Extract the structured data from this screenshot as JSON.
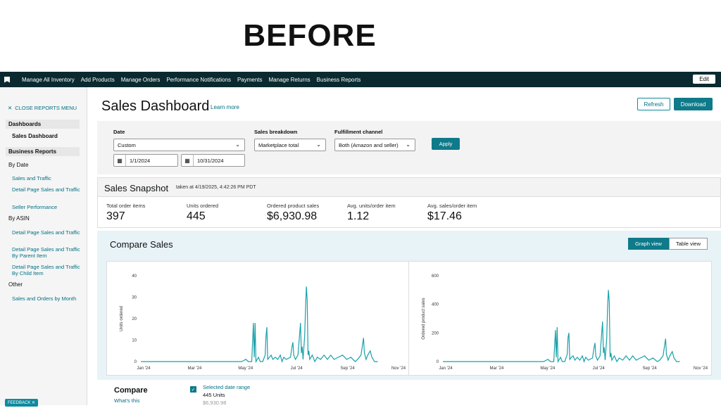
{
  "headline": "BEFORE",
  "topnav": {
    "items": [
      "Manage All Inventory",
      "Add Products",
      "Manage Orders",
      "Performance Notifications",
      "Payments",
      "Manage Returns",
      "Business Reports"
    ],
    "edit_label": "Edit"
  },
  "sidebar": {
    "close_label": "CLOSE REPORTS MENU",
    "dashboards_heading": "Dashboards",
    "sales_dashboard": "Sales Dashboard",
    "business_reports_heading": "Business Reports",
    "by_date_label": "By Date",
    "by_date_links": [
      "Sales and Traffic",
      "Detail Page Sales and Traffic",
      "Seller Performance"
    ],
    "by_asin_label": "By ASIN",
    "by_asin_links": [
      "Detail Page Sales and Traffic",
      "Detail Page Sales and Traffic By Parent Item",
      "Detail Page Sales and Traffic By Child Item"
    ],
    "other_label": "Other",
    "other_links": [
      "Sales and Orders by Month"
    ],
    "feedback_label": "FEEDBACK ✕"
  },
  "page": {
    "title": "Sales Dashboard",
    "learn_more": "Learn more",
    "refresh_label": "Refresh",
    "download_label": "Download"
  },
  "filters": {
    "date_label": "Date",
    "date_value": "Custom",
    "start_date": "1/1/2024",
    "end_date": "10/31/2024",
    "breakdown_label": "Sales breakdown",
    "breakdown_value": "Marketplace total",
    "channel_label": "Fulfillment channel",
    "channel_value": "Both (Amazon and seller)",
    "apply_label": "Apply"
  },
  "snapshot": {
    "title": "Sales Snapshot",
    "taken": "taken at 4/19/2025, 4:42:26 PM PDT",
    "metrics": [
      {
        "label": "Total order items",
        "value": "397"
      },
      {
        "label": "Units ordered",
        "value": "445"
      },
      {
        "label": "Ordered product sales",
        "value": "$6,930.98"
      },
      {
        "label": "Avg. units/order item",
        "value": "1.12"
      },
      {
        "label": "Avg. sales/order item",
        "value": "$17.46"
      }
    ]
  },
  "compare": {
    "title": "Compare Sales",
    "graph_view": "Graph view",
    "table_view": "Table view",
    "footer_title": "Compare",
    "whats_this": "What's this",
    "selected_range": "Selected date range",
    "units_text": "445 Units",
    "sales_text_partial": "$6,930.98"
  },
  "colors": {
    "nav_bg": "#0a2a30",
    "accent": "#0e7a8a",
    "link": "#007185",
    "line": "#1aa0aa"
  },
  "chart_data": [
    {
      "type": "line",
      "ylabel": "Units ordered",
      "ylim": [
        0,
        40
      ],
      "yticks": [
        0,
        10,
        20,
        30,
        40
      ],
      "xticks": [
        "Jan '24",
        "Mar '24",
        "May '24",
        "Jul '24",
        "Sep '24",
        "Nov '24"
      ],
      "x_range_days": [
        0,
        310
      ],
      "points": [
        [
          0,
          0
        ],
        [
          120,
          0
        ],
        [
          125,
          1
        ],
        [
          128,
          0
        ],
        [
          132,
          0
        ],
        [
          134,
          18
        ],
        [
          135,
          2
        ],
        [
          136,
          18
        ],
        [
          137,
          0
        ],
        [
          140,
          2
        ],
        [
          142,
          0
        ],
        [
          145,
          0
        ],
        [
          148,
          3
        ],
        [
          149,
          12
        ],
        [
          150,
          16
        ],
        [
          151,
          1
        ],
        [
          153,
          2
        ],
        [
          155,
          3
        ],
        [
          157,
          1
        ],
        [
          160,
          2
        ],
        [
          163,
          1
        ],
        [
          166,
          3
        ],
        [
          168,
          0
        ],
        [
          170,
          2
        ],
        [
          173,
          1
        ],
        [
          178,
          2
        ],
        [
          180,
          7
        ],
        [
          181,
          9
        ],
        [
          182,
          3
        ],
        [
          184,
          1
        ],
        [
          187,
          3
        ],
        [
          190,
          18
        ],
        [
          191,
          4
        ],
        [
          192,
          7
        ],
        [
          193,
          1
        ],
        [
          195,
          12
        ],
        [
          196,
          24
        ],
        [
          197,
          35
        ],
        [
          198,
          29
        ],
        [
          199,
          3
        ],
        [
          200,
          5
        ],
        [
          201,
          1
        ],
        [
          204,
          3
        ],
        [
          207,
          0
        ],
        [
          210,
          2
        ],
        [
          214,
          1
        ],
        [
          218,
          3
        ],
        [
          222,
          1
        ],
        [
          226,
          3
        ],
        [
          230,
          1
        ],
        [
          235,
          2
        ],
        [
          240,
          3
        ],
        [
          245,
          1
        ],
        [
          250,
          2
        ],
        [
          255,
          0
        ],
        [
          258,
          1
        ],
        [
          262,
          3
        ],
        [
          265,
          11
        ],
        [
          266,
          4
        ],
        [
          268,
          1
        ],
        [
          270,
          3
        ],
        [
          273,
          5
        ],
        [
          275,
          2
        ],
        [
          278,
          0
        ],
        [
          282,
          0
        ]
      ]
    },
    {
      "type": "line",
      "ylabel": "Ordered product sales",
      "ylim": [
        0,
        600
      ],
      "yticks": [
        0,
        200,
        400,
        600
      ],
      "xticks": [
        "Jan '24",
        "Mar '24",
        "May '24",
        "Jul '24",
        "Sep '24",
        "Nov '24"
      ],
      "x_range_days": [
        0,
        310
      ],
      "points": [
        [
          0,
          0
        ],
        [
          120,
          0
        ],
        [
          125,
          15
        ],
        [
          128,
          0
        ],
        [
          132,
          0
        ],
        [
          134,
          220
        ],
        [
          135,
          30
        ],
        [
          136,
          240
        ],
        [
          137,
          0
        ],
        [
          140,
          30
        ],
        [
          142,
          0
        ],
        [
          145,
          0
        ],
        [
          148,
          50
        ],
        [
          149,
          170
        ],
        [
          150,
          200
        ],
        [
          151,
          15
        ],
        [
          153,
          30
        ],
        [
          155,
          40
        ],
        [
          157,
          10
        ],
        [
          160,
          30
        ],
        [
          163,
          10
        ],
        [
          166,
          40
        ],
        [
          168,
          0
        ],
        [
          170,
          30
        ],
        [
          173,
          10
        ],
        [
          178,
          25
        ],
        [
          180,
          100
        ],
        [
          181,
          130
        ],
        [
          182,
          40
        ],
        [
          184,
          10
        ],
        [
          187,
          40
        ],
        [
          190,
          280
        ],
        [
          191,
          60
        ],
        [
          192,
          100
        ],
        [
          193,
          10
        ],
        [
          195,
          160
        ],
        [
          196,
          380
        ],
        [
          197,
          500
        ],
        [
          198,
          420
        ],
        [
          199,
          30
        ],
        [
          200,
          60
        ],
        [
          201,
          10
        ],
        [
          204,
          40
        ],
        [
          207,
          0
        ],
        [
          210,
          25
        ],
        [
          214,
          10
        ],
        [
          218,
          40
        ],
        [
          222,
          10
        ],
        [
          226,
          40
        ],
        [
          230,
          10
        ],
        [
          235,
          25
        ],
        [
          240,
          40
        ],
        [
          245,
          10
        ],
        [
          250,
          25
        ],
        [
          255,
          0
        ],
        [
          258,
          10
        ],
        [
          262,
          40
        ],
        [
          265,
          160
        ],
        [
          266,
          50
        ],
        [
          268,
          10
        ],
        [
          270,
          40
        ],
        [
          273,
          70
        ],
        [
          275,
          25
        ],
        [
          278,
          0
        ],
        [
          282,
          0
        ]
      ]
    }
  ]
}
